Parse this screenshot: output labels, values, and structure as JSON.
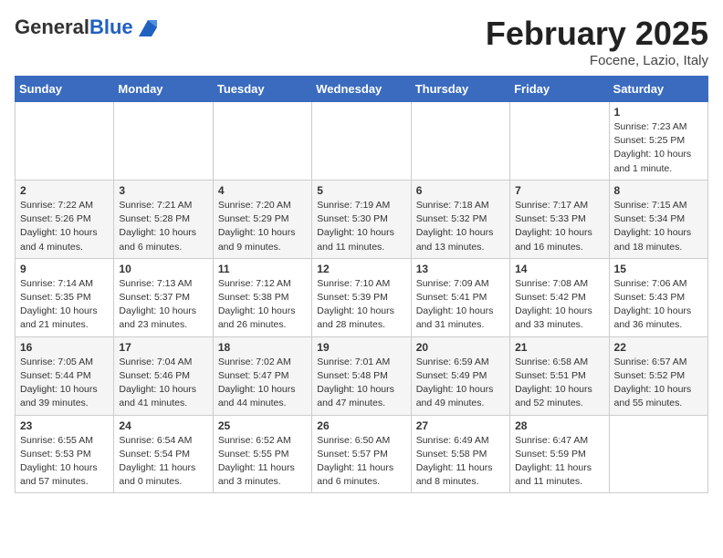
{
  "header": {
    "logo_general": "General",
    "logo_blue": "Blue",
    "month_title": "February 2025",
    "location": "Focene, Lazio, Italy"
  },
  "weekdays": [
    "Sunday",
    "Monday",
    "Tuesday",
    "Wednesday",
    "Thursday",
    "Friday",
    "Saturday"
  ],
  "weeks": [
    [
      {
        "day": "",
        "info": ""
      },
      {
        "day": "",
        "info": ""
      },
      {
        "day": "",
        "info": ""
      },
      {
        "day": "",
        "info": ""
      },
      {
        "day": "",
        "info": ""
      },
      {
        "day": "",
        "info": ""
      },
      {
        "day": "1",
        "info": "Sunrise: 7:23 AM\nSunset: 5:25 PM\nDaylight: 10 hours\nand 1 minute."
      }
    ],
    [
      {
        "day": "2",
        "info": "Sunrise: 7:22 AM\nSunset: 5:26 PM\nDaylight: 10 hours\nand 4 minutes."
      },
      {
        "day": "3",
        "info": "Sunrise: 7:21 AM\nSunset: 5:28 PM\nDaylight: 10 hours\nand 6 minutes."
      },
      {
        "day": "4",
        "info": "Sunrise: 7:20 AM\nSunset: 5:29 PM\nDaylight: 10 hours\nand 9 minutes."
      },
      {
        "day": "5",
        "info": "Sunrise: 7:19 AM\nSunset: 5:30 PM\nDaylight: 10 hours\nand 11 minutes."
      },
      {
        "day": "6",
        "info": "Sunrise: 7:18 AM\nSunset: 5:32 PM\nDaylight: 10 hours\nand 13 minutes."
      },
      {
        "day": "7",
        "info": "Sunrise: 7:17 AM\nSunset: 5:33 PM\nDaylight: 10 hours\nand 16 minutes."
      },
      {
        "day": "8",
        "info": "Sunrise: 7:15 AM\nSunset: 5:34 PM\nDaylight: 10 hours\nand 18 minutes."
      }
    ],
    [
      {
        "day": "9",
        "info": "Sunrise: 7:14 AM\nSunset: 5:35 PM\nDaylight: 10 hours\nand 21 minutes."
      },
      {
        "day": "10",
        "info": "Sunrise: 7:13 AM\nSunset: 5:37 PM\nDaylight: 10 hours\nand 23 minutes."
      },
      {
        "day": "11",
        "info": "Sunrise: 7:12 AM\nSunset: 5:38 PM\nDaylight: 10 hours\nand 26 minutes."
      },
      {
        "day": "12",
        "info": "Sunrise: 7:10 AM\nSunset: 5:39 PM\nDaylight: 10 hours\nand 28 minutes."
      },
      {
        "day": "13",
        "info": "Sunrise: 7:09 AM\nSunset: 5:41 PM\nDaylight: 10 hours\nand 31 minutes."
      },
      {
        "day": "14",
        "info": "Sunrise: 7:08 AM\nSunset: 5:42 PM\nDaylight: 10 hours\nand 33 minutes."
      },
      {
        "day": "15",
        "info": "Sunrise: 7:06 AM\nSunset: 5:43 PM\nDaylight: 10 hours\nand 36 minutes."
      }
    ],
    [
      {
        "day": "16",
        "info": "Sunrise: 7:05 AM\nSunset: 5:44 PM\nDaylight: 10 hours\nand 39 minutes."
      },
      {
        "day": "17",
        "info": "Sunrise: 7:04 AM\nSunset: 5:46 PM\nDaylight: 10 hours\nand 41 minutes."
      },
      {
        "day": "18",
        "info": "Sunrise: 7:02 AM\nSunset: 5:47 PM\nDaylight: 10 hours\nand 44 minutes."
      },
      {
        "day": "19",
        "info": "Sunrise: 7:01 AM\nSunset: 5:48 PM\nDaylight: 10 hours\nand 47 minutes."
      },
      {
        "day": "20",
        "info": "Sunrise: 6:59 AM\nSunset: 5:49 PM\nDaylight: 10 hours\nand 49 minutes."
      },
      {
        "day": "21",
        "info": "Sunrise: 6:58 AM\nSunset: 5:51 PM\nDaylight: 10 hours\nand 52 minutes."
      },
      {
        "day": "22",
        "info": "Sunrise: 6:57 AM\nSunset: 5:52 PM\nDaylight: 10 hours\nand 55 minutes."
      }
    ],
    [
      {
        "day": "23",
        "info": "Sunrise: 6:55 AM\nSunset: 5:53 PM\nDaylight: 10 hours\nand 57 minutes."
      },
      {
        "day": "24",
        "info": "Sunrise: 6:54 AM\nSunset: 5:54 PM\nDaylight: 11 hours\nand 0 minutes."
      },
      {
        "day": "25",
        "info": "Sunrise: 6:52 AM\nSunset: 5:55 PM\nDaylight: 11 hours\nand 3 minutes."
      },
      {
        "day": "26",
        "info": "Sunrise: 6:50 AM\nSunset: 5:57 PM\nDaylight: 11 hours\nand 6 minutes."
      },
      {
        "day": "27",
        "info": "Sunrise: 6:49 AM\nSunset: 5:58 PM\nDaylight: 11 hours\nand 8 minutes."
      },
      {
        "day": "28",
        "info": "Sunrise: 6:47 AM\nSunset: 5:59 PM\nDaylight: 11 hours\nand 11 minutes."
      },
      {
        "day": "",
        "info": ""
      }
    ]
  ]
}
